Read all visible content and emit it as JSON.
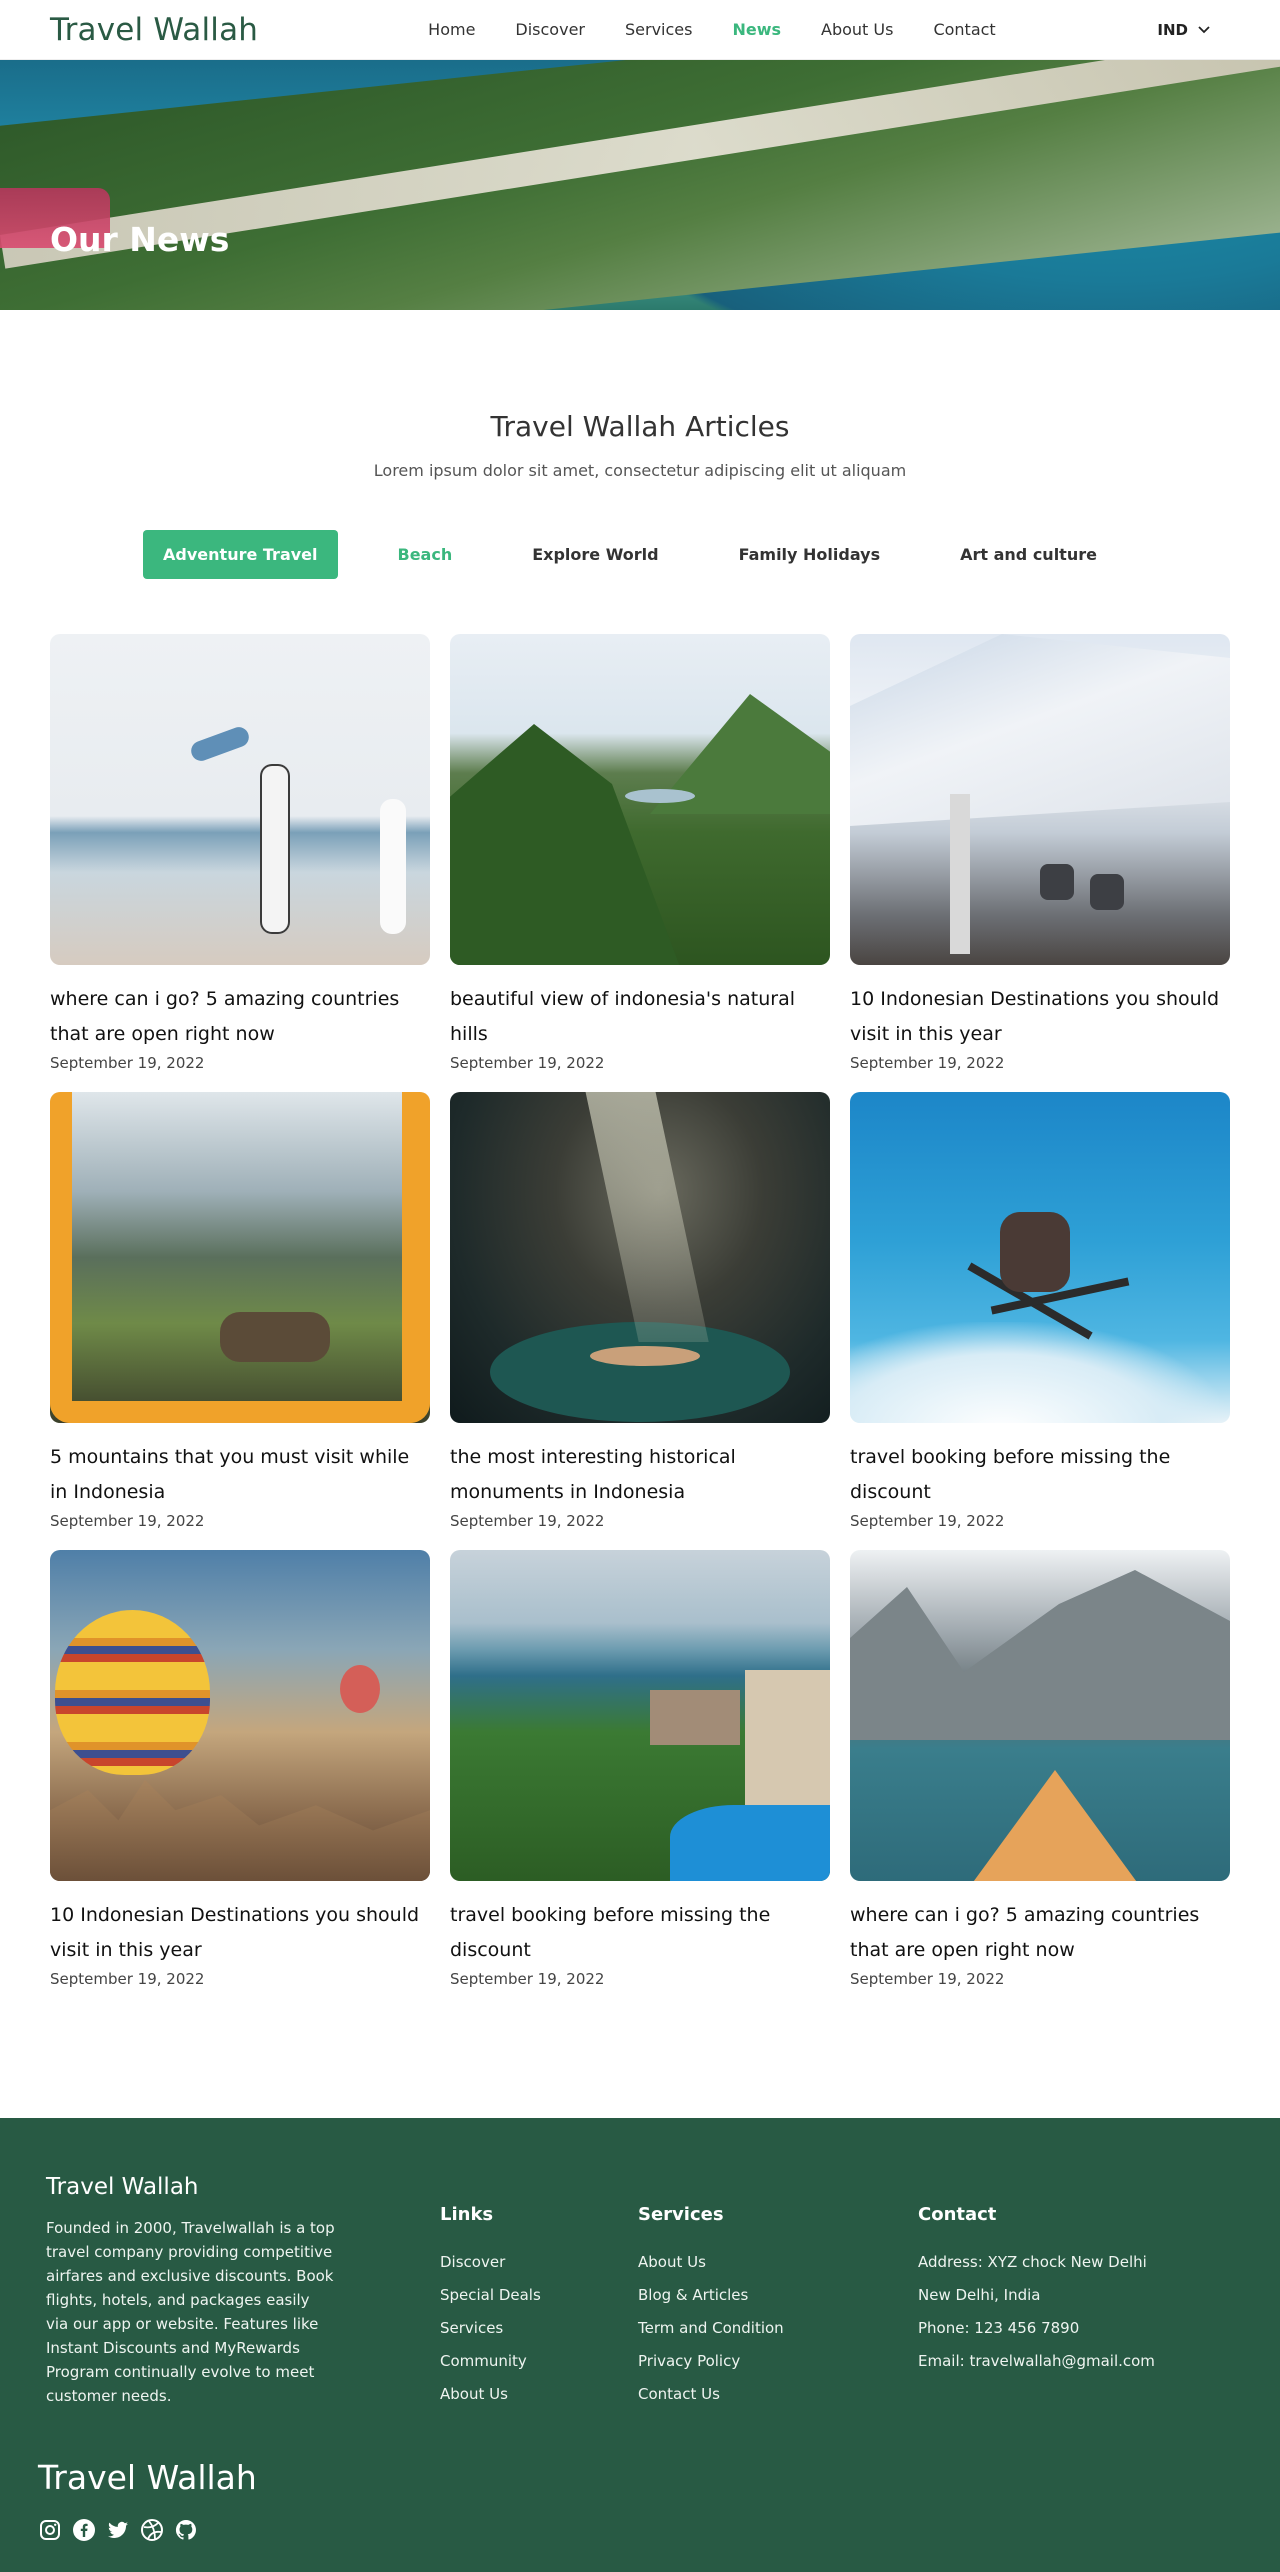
{
  "header": {
    "logo": "Travel Wallah",
    "nav": [
      "Home",
      "Discover",
      "Services",
      "News",
      "About Us",
      "Contact"
    ],
    "active_nav": "News",
    "language": "IND"
  },
  "hero": {
    "title": "Our News"
  },
  "articles_section": {
    "title": "Travel Wallah Articles",
    "subtitle": "Lorem ipsum dolor sit amet, consectetur adipiscing elit ut aliquam",
    "filters": [
      "Adventure Travel",
      "Beach",
      "Explore World",
      "Family Holidays",
      "Art and culture"
    ],
    "active_filter": "Adventure Travel"
  },
  "articles": [
    {
      "title": "where can i go? 5 amazing countries that are open right now",
      "date": "September 19, 2022"
    },
    {
      "title": "beautiful view of indonesia's natural hills",
      "date": "September 19, 2022"
    },
    {
      "title": "10 Indonesian Destinations you should visit in this year",
      "date": "September 19, 2022"
    },
    {
      "title": "5 mountains that you must visit while in Indonesia",
      "date": "September 19, 2022"
    },
    {
      "title": "the most interesting historical monuments in Indonesia",
      "date": "September 19, 2022"
    },
    {
      "title": "travel booking before missing the discount",
      "date": "September 19, 2022"
    },
    {
      "title": "10 Indonesian Destinations you should visit in this year",
      "date": "September 19, 2022"
    },
    {
      "title": "travel booking before missing the discount",
      "date": "September 19, 2022"
    },
    {
      "title": "where can i go? 5 amazing countries that are open right now",
      "date": "September 19, 2022"
    }
  ],
  "footer": {
    "brand": "Travel Wallah",
    "about": "Founded in 2000, Travelwallah is a top travel company providing competitive airfares and exclusive discounts. Book flights, hotels, and packages easily via our app or website. Features like Instant Discounts and MyRewards Program continually evolve to meet customer needs.",
    "links": {
      "title": "Links",
      "items": [
        "Discover",
        "Special Deals",
        "Services",
        "Community",
        "About Us"
      ]
    },
    "services": {
      "title": "Services",
      "items": [
        "About Us",
        "Blog & Articles",
        "Term and Condition",
        "Privacy Policy",
        "Contact Us"
      ]
    },
    "contact": {
      "title": "Contact",
      "items": [
        "Address: XYZ chock New Delhi",
        "New Delhi, India",
        "Phone: 123 456 7890",
        "Email: travelwallah@gmail.com"
      ]
    },
    "brand_large": "Travel Wallah",
    "social": [
      "instagram-icon",
      "facebook-icon",
      "twitter-icon",
      "dribbble-icon",
      "github-icon"
    ]
  },
  "colors": {
    "accent": "#3bb77e",
    "footer_bg": "#285a44",
    "logo": "#2a5a44"
  }
}
